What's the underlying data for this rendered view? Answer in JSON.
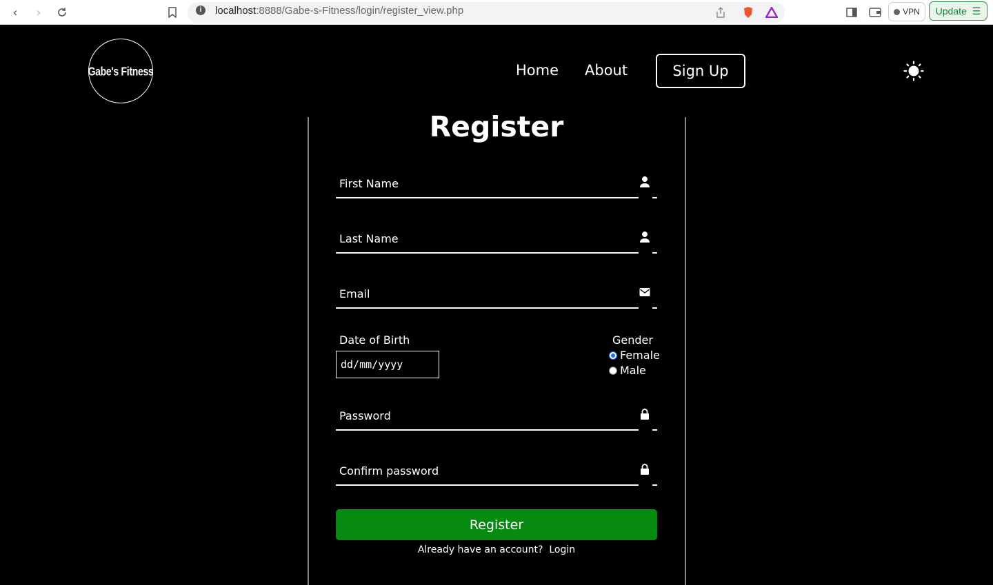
{
  "browser": {
    "url_host": "localhost",
    "url_path": ":8888/Gabe-s-Fitness/login/register_view.php",
    "vpn_label": "VPN",
    "update_label": "Update"
  },
  "header": {
    "logo_text": "Gabe's Fitness",
    "nav": {
      "home": "Home",
      "about": "About",
      "signup": "Sign Up"
    }
  },
  "form": {
    "title": "Register",
    "first_name": "First Name",
    "last_name": "Last Name",
    "email": "Email",
    "dob_label": "Date of Birth",
    "dob_placeholder": "dd/mm/yyyy",
    "gender_label": "Gender",
    "gender_options": [
      "Female",
      "Male"
    ],
    "gender_selected": "Female",
    "password": "Password",
    "confirm_password": "Confirm password",
    "submit": "Register",
    "login_prompt": "Already have an account?",
    "login_link": "Login"
  },
  "colors": {
    "background": "#000000",
    "register_button": "#068b10",
    "radio_selected": "#1a6cf0"
  }
}
